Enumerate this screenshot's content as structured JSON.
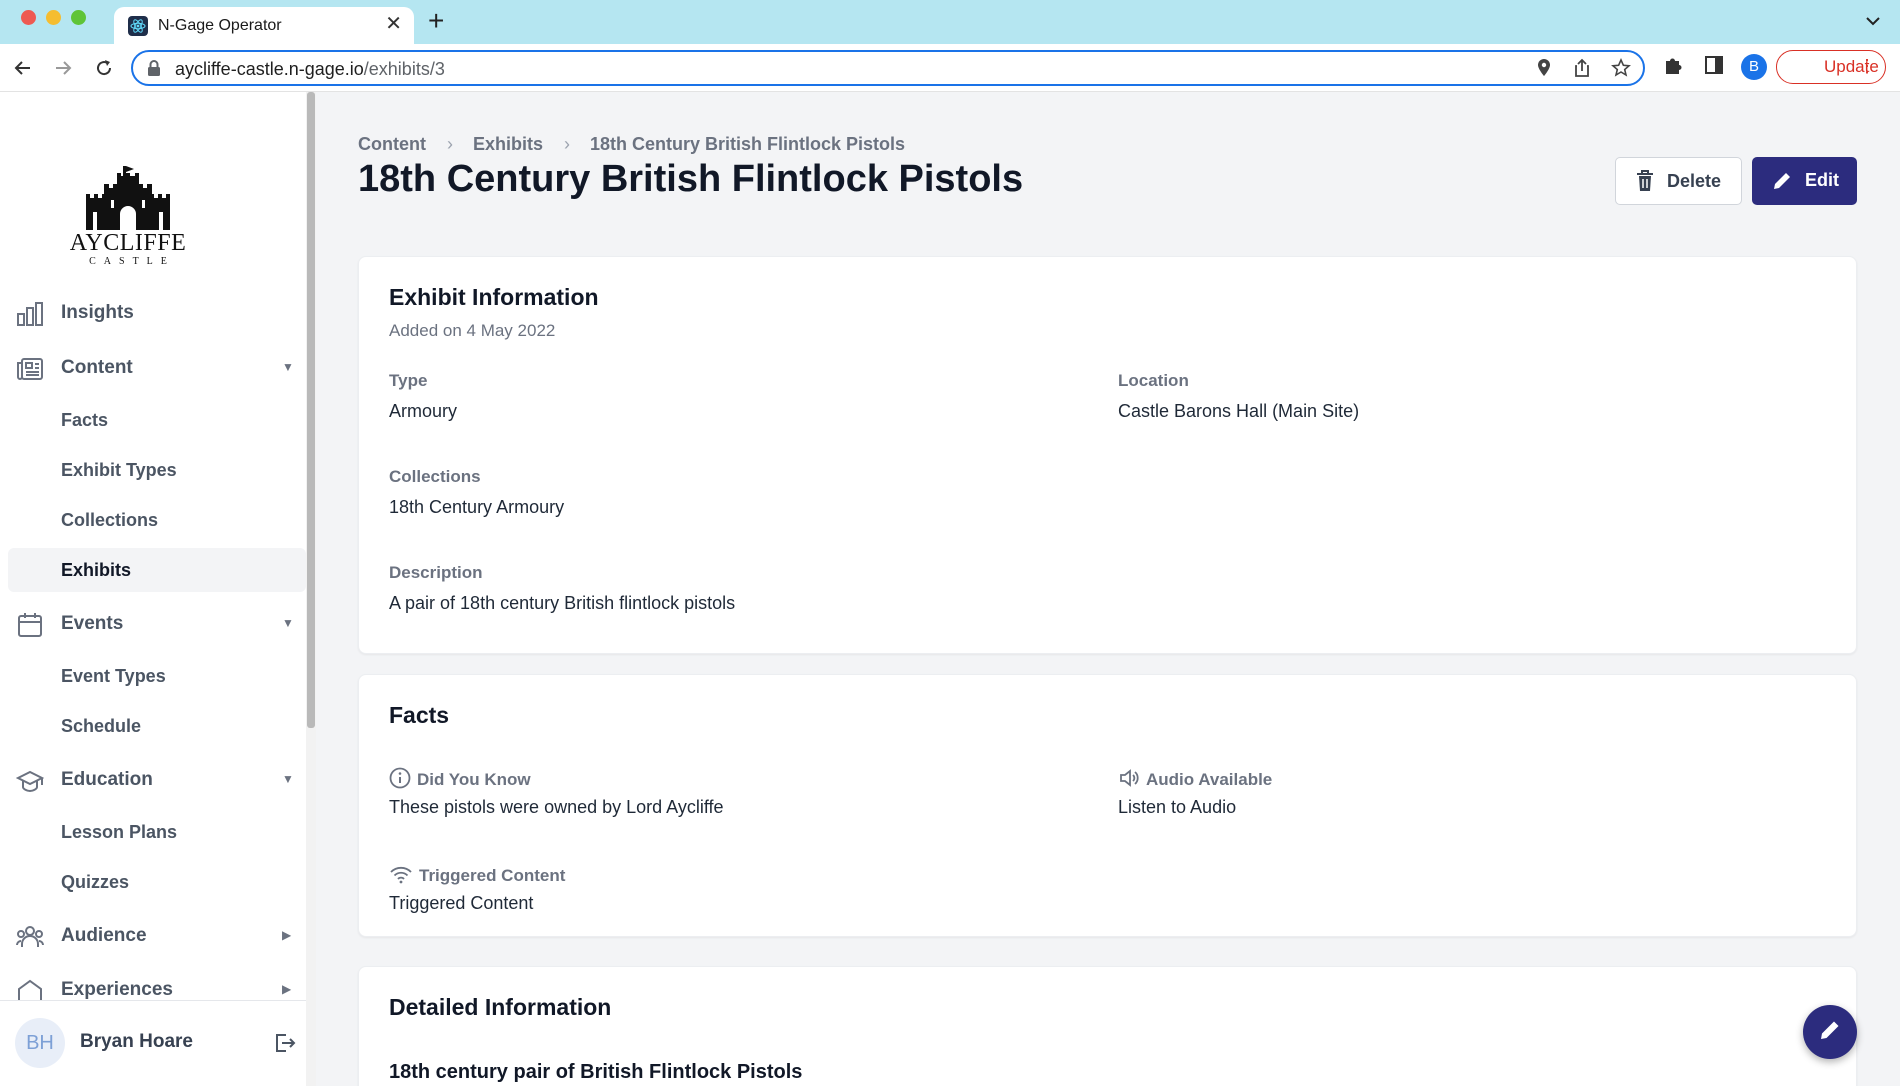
{
  "browser": {
    "tab_title": "N-Gage Operator",
    "tab_close": "✕",
    "new_tab": "+",
    "url_host": "aycliffe-castle.n-gage.io",
    "url_path": "/exhibits/3",
    "profile_initial": "B",
    "update_label": "Update"
  },
  "sidebar": {
    "logo_text": "AYCLIFFE",
    "logo_sub": "CASTLE",
    "items": [
      {
        "label": "Insights",
        "icon": "bar-chart-icon"
      },
      {
        "label": "Content",
        "icon": "newspaper-icon",
        "expanded": true
      },
      {
        "label": "Facts"
      },
      {
        "label": "Exhibit Types"
      },
      {
        "label": "Collections"
      },
      {
        "label": "Exhibits",
        "active": true
      },
      {
        "label": "Events",
        "icon": "calendar-icon",
        "expanded": true
      },
      {
        "label": "Event Types"
      },
      {
        "label": "Schedule"
      },
      {
        "label": "Education",
        "icon": "graduation-cap-icon",
        "expanded": true
      },
      {
        "label": "Lesson Plans"
      },
      {
        "label": "Quizzes"
      },
      {
        "label": "Audience",
        "icon": "users-icon",
        "expanded": false
      },
      {
        "label": "Experiences",
        "icon": "experiences-icon",
        "expanded": false
      }
    ],
    "user": {
      "initials": "BH",
      "name": "Bryan Hoare"
    }
  },
  "main": {
    "breadcrumb": [
      "Content",
      "Exhibits",
      "18th Century British Flintlock Pistols"
    ],
    "title": "18th Century British Flintlock Pistols",
    "delete_label": "Delete",
    "edit_label": "Edit",
    "exhibit_info": {
      "title": "Exhibit Information",
      "added": "Added on 4 May 2022",
      "type_label": "Type",
      "type_value": "Armoury",
      "location_label": "Location",
      "location_value": "Castle Barons Hall (Main Site)",
      "collections_label": "Collections",
      "collections_value": "18th Century Armoury",
      "description_label": "Description",
      "description_value": "A pair of 18th century British flintlock pistols"
    },
    "facts": {
      "title": "Facts",
      "did_you_know_label": "Did You Know",
      "did_you_know_value": "These pistols were owned by Lord Aycliffe",
      "audio_label": "Audio Available",
      "audio_value": "Listen to Audio",
      "triggered_label": "Triggered Content",
      "triggered_value": "Triggered Content"
    },
    "detailed": {
      "title": "Detailed Information",
      "heading": "18th century pair of British Flintlock Pistols"
    }
  },
  "colors": {
    "primary": "#2c2c7e",
    "tabbar": "#b5e6f1",
    "update": "#d93025",
    "content_bg": "#f3f4f6"
  }
}
